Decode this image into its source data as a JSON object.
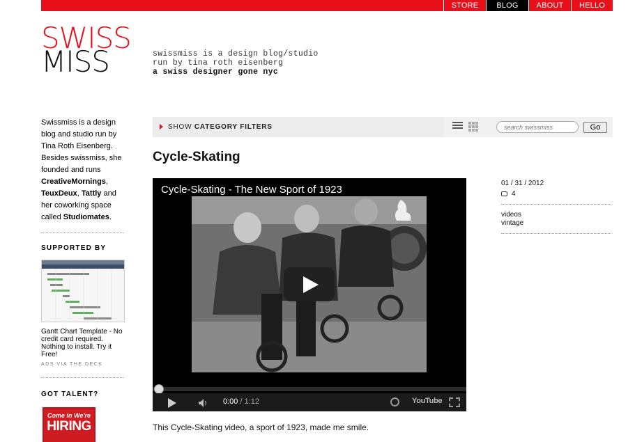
{
  "nav": {
    "items": [
      "STORE",
      "BLOG",
      "ABOUT",
      "HELLO"
    ],
    "active": "BLOG"
  },
  "logo": {
    "line1": "SWISS",
    "line2": "MISS"
  },
  "tagline": {
    "line1": "swissmiss is a design blog/studio",
    "line2": "run by tina roth eisenberg",
    "line3": "a swiss designer gone nyc"
  },
  "sidebar": {
    "intro_prefix": "Swissmiss is a design blog and studio run by Tina Roth Eisenberg. Besides swissmiss, she founded and runs ",
    "link_creativemornings": "CreativeMornings",
    "sep1": ", ",
    "link_teuxdeux": "TeuxDeux",
    "sep2": ", ",
    "link_tattly": "Tattly",
    "mid": " and her coworking space called ",
    "link_studiomates": "Studiomates",
    "end": ".",
    "supported_heading": "SUPPORTED BY",
    "ad_text": "Gantt Chart Template - No credit card required. Nothing to install. Try it Free!",
    "ads_via": "ADS VIA THE DECK",
    "talent_heading": "GOT TALENT?",
    "hiring_top": "Come in We're",
    "hiring_main": "HIRING"
  },
  "filter": {
    "prefix": "SHOW ",
    "strong": "CATEGORY FILTERS",
    "search_placeholder": "search swissmiss",
    "go_label": "Go"
  },
  "post": {
    "title": "Cycle-Skating",
    "video_title": "Cycle-Skating - The New Sport of 1923",
    "time_current": "0:00",
    "time_sep": " / ",
    "time_duration": "1:12",
    "youtube_label": "YouTube",
    "caption": "This Cycle-Skating video, a sport of 1923, made me smile.",
    "date": "01 / 31 / 2012",
    "comments": "4",
    "tags": [
      "videos",
      "vintage"
    ]
  },
  "colors": {
    "accent": "#e8101a",
    "nav_active": "#000000"
  }
}
